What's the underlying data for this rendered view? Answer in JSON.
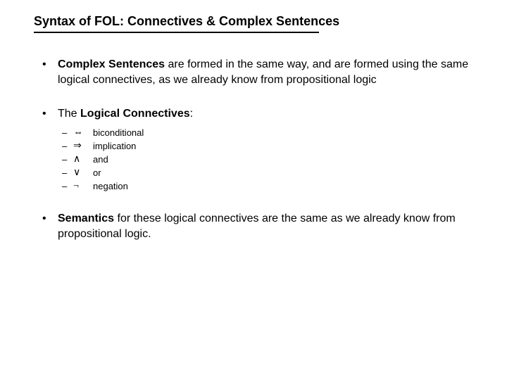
{
  "title": "Syntax of FOL: Connectives & Complex Sentences",
  "bullets": {
    "b1": {
      "bold": "Complex Sentences",
      "rest": " are formed in the same way, and are formed using the same logical connectives, as we already know from propositional logic"
    },
    "b2": {
      "pre": "The ",
      "bold": "Logical Connectives",
      "post": ":"
    },
    "connectives": [
      {
        "sym": "⇔",
        "label": "biconditional"
      },
      {
        "sym": "⇒",
        "label": "implication"
      },
      {
        "sym": "∧",
        "label": "and"
      },
      {
        "sym": "∨",
        "label": "or"
      },
      {
        "sym": "¬",
        "label": "negation"
      }
    ],
    "b3": {
      "bold": "Semantics",
      "rest": " for these logical connectives are the same as we already know from propositional logic."
    }
  },
  "glyphs": {
    "bullet": "•",
    "dash": "–"
  }
}
